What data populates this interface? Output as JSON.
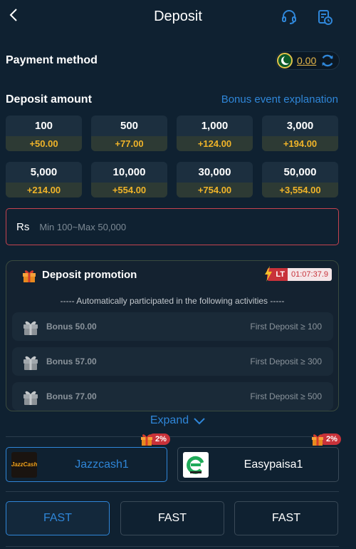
{
  "header": {
    "title": "Deposit",
    "icons": [
      "back-arrow-icon",
      "headset-icon",
      "records-icon"
    ]
  },
  "payment": {
    "label": "Payment method",
    "balance": "0.00",
    "flag": "pakistan-flag-icon"
  },
  "deposit": {
    "label": "Deposit amount",
    "bonus_link": "Bonus event explanation",
    "options": [
      {
        "amount": "100",
        "bonus": "+50.00"
      },
      {
        "amount": "500",
        "bonus": "+77.00"
      },
      {
        "amount": "1,000",
        "bonus": "+124.00"
      },
      {
        "amount": "3,000",
        "bonus": "+194.00"
      },
      {
        "amount": "5,000",
        "bonus": "+214.00"
      },
      {
        "amount": "10,000",
        "bonus": "+554.00"
      },
      {
        "amount": "30,000",
        "bonus": "+754.00"
      },
      {
        "amount": "50,000",
        "bonus": "+3,554.00"
      }
    ],
    "currency": "Rs",
    "input_placeholder": "Min 100~Max 50,000",
    "input_value": ""
  },
  "promotion": {
    "title": "Deposit promotion",
    "lt_badge": "LT",
    "timer": "01:07:37.9",
    "note": "----- Automatically participated in the following activities -----",
    "items": [
      {
        "bonus": "Bonus 50.00",
        "condition": "First Deposit ≥ 100"
      },
      {
        "bonus": "Bonus 57.00",
        "condition": "First Deposit ≥ 300"
      },
      {
        "bonus": "Bonus 77.00",
        "condition": "First Deposit ≥ 500"
      }
    ],
    "expand_label": "Expand"
  },
  "channels": [
    {
      "name": "Jazzcash1",
      "badge": "2%",
      "logo_text": "JazzCash",
      "active": true
    },
    {
      "name": "Easypaisa1",
      "badge": "2%",
      "active": false
    }
  ],
  "speed_options": [
    {
      "label": "FAST",
      "active": true
    },
    {
      "label": "FAST",
      "active": false
    },
    {
      "label": "FAST",
      "active": false
    }
  ],
  "colors": {
    "accent": "#2f86d8",
    "bonus": "#f0b429",
    "danger": "#c8323a",
    "background": "#0f2131"
  }
}
